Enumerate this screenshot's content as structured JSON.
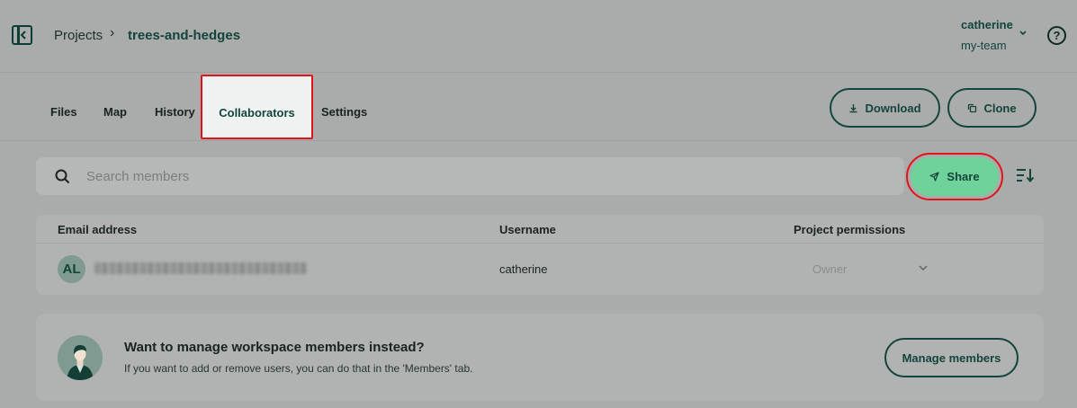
{
  "breadcrumb": {
    "projects_label": "Projects",
    "separator": "›",
    "current": "trees-and-hedges"
  },
  "user": {
    "name": "catherine",
    "team": "my-team"
  },
  "help_label": "?",
  "tabs": [
    {
      "label": "Files",
      "active": false
    },
    {
      "label": "Map",
      "active": false
    },
    {
      "label": "History",
      "active": false
    },
    {
      "label": "Collaborators",
      "active": true
    },
    {
      "label": "Settings",
      "active": false
    }
  ],
  "actions": {
    "download_label": "Download",
    "clone_label": "Clone"
  },
  "search": {
    "placeholder": "Search members"
  },
  "share_label": "Share",
  "table": {
    "headers": [
      "Email address",
      "Username",
      "Project permissions"
    ],
    "rows": [
      {
        "initials": "AL",
        "username": "catherine",
        "permission": "Owner"
      }
    ]
  },
  "manage_card": {
    "title": "Want to manage workspace members instead?",
    "description": "If you want to add or remove users, you can do that in the 'Members' tab.",
    "button_label": "Manage members"
  },
  "colors": {
    "brand": "#14443b",
    "share_green": "#6fd29a",
    "highlight_red": "#e0151b"
  }
}
